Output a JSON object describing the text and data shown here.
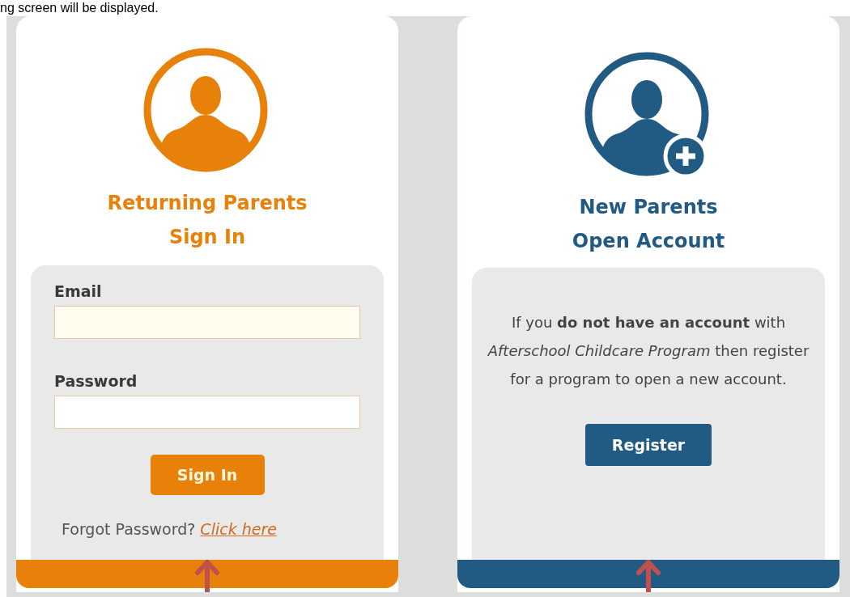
{
  "header_text": "ng screen will be displayed.",
  "returning": {
    "title_lines": [
      "Returning Parents",
      "Sign In"
    ],
    "fields": [
      {
        "label": "Email"
      },
      {
        "label": "Password"
      }
    ],
    "button": "Sign In",
    "forgot": {
      "text": "Forgot Password?",
      "link": "Click here"
    }
  },
  "new_account": {
    "title_lines": [
      "New Parents",
      "Open Account"
    ],
    "message": "If you **do not have an account** with *Afterschool Childcare Program* then register for a program to open a new account.",
    "button": "Register"
  }
}
